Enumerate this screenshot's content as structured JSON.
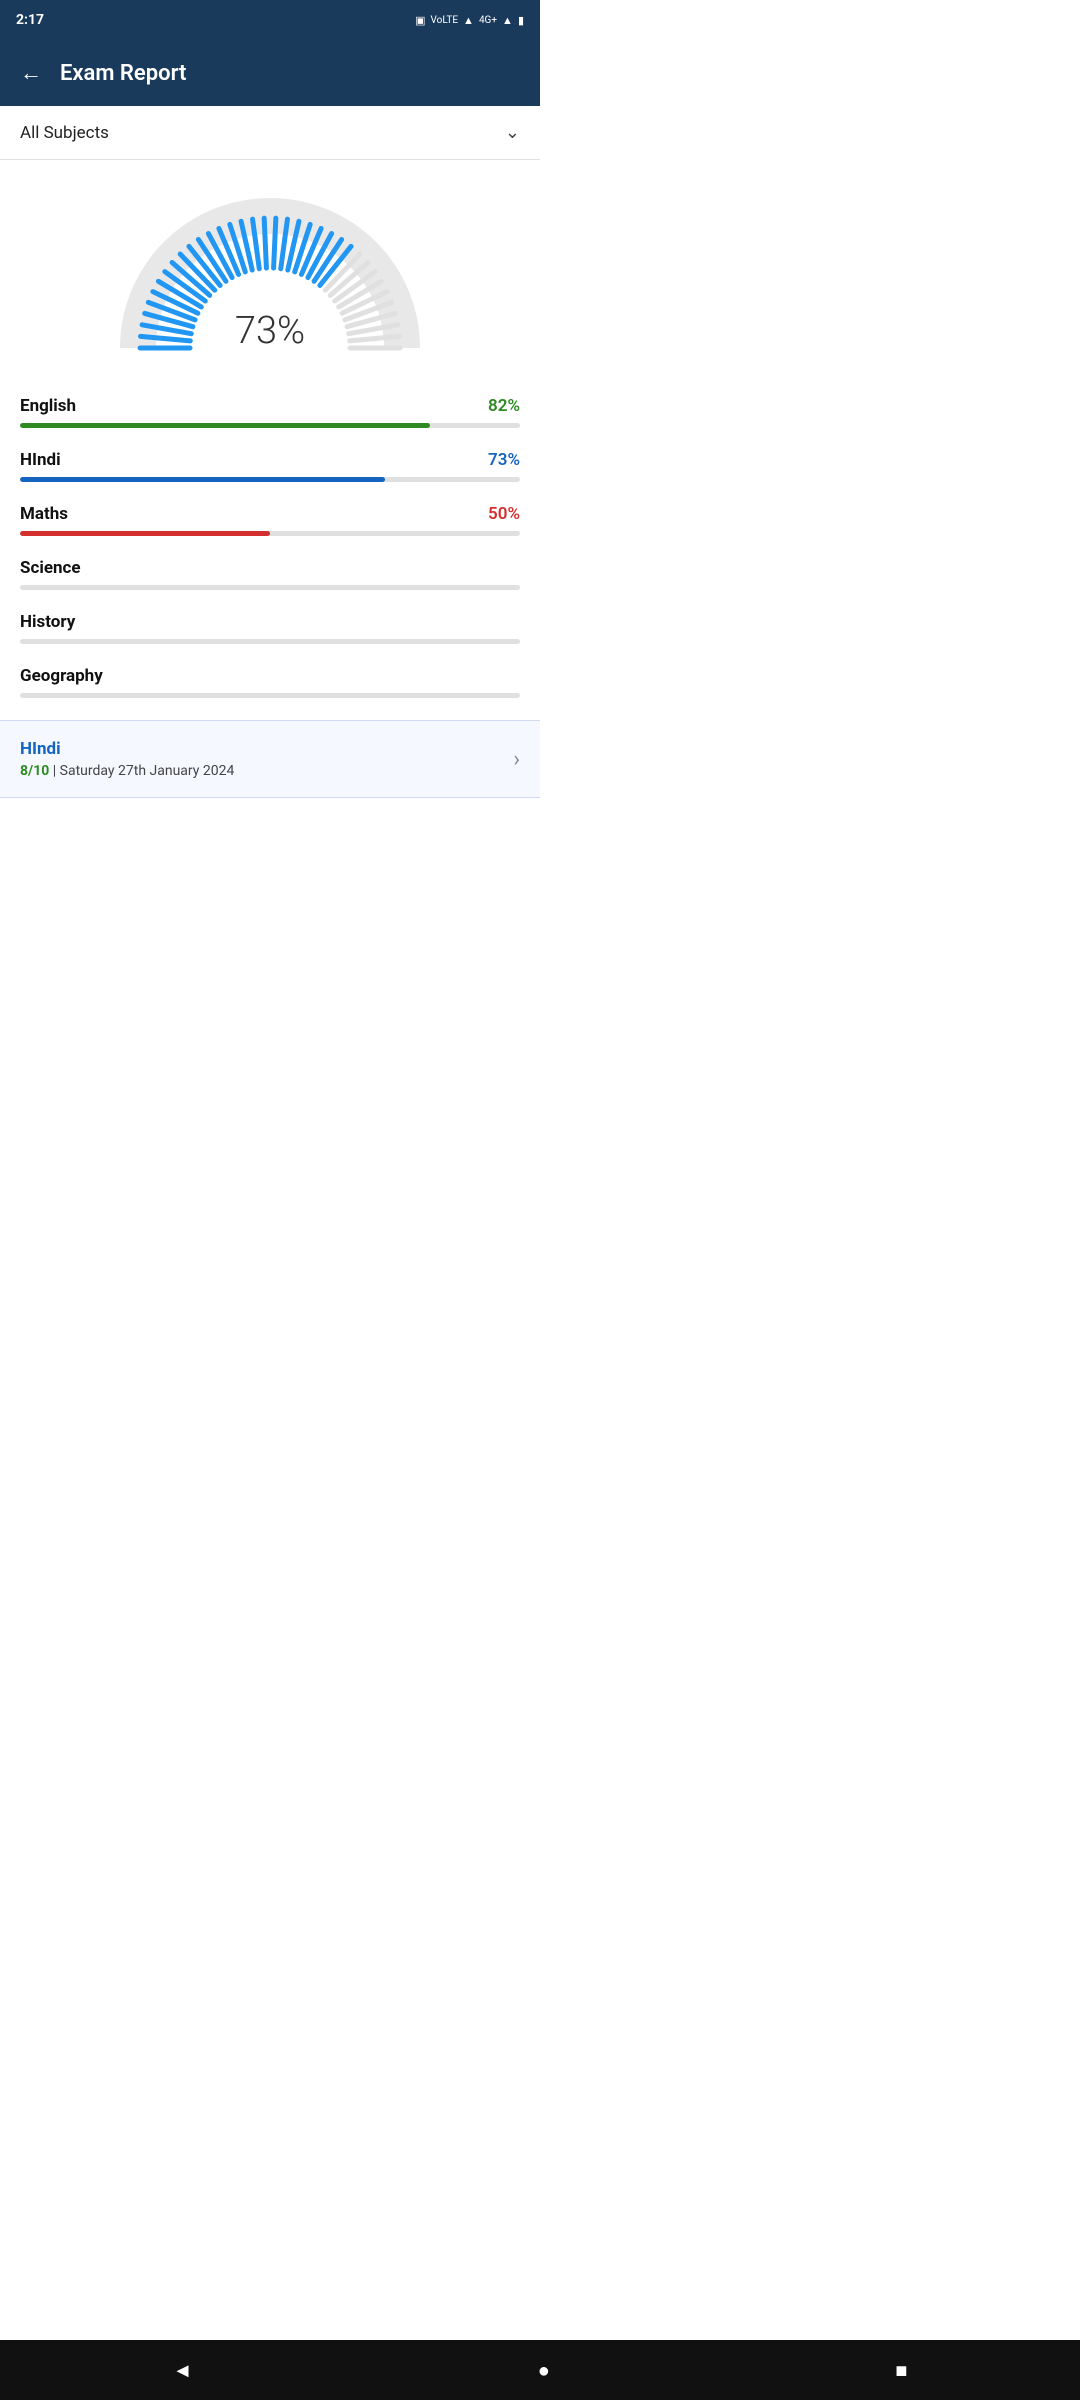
{
  "statusBar": {
    "time": "2:17",
    "icons": [
      "vibrate",
      "volte",
      "wifi",
      "4g+",
      "signal",
      "battery"
    ]
  },
  "header": {
    "backArrow": "←",
    "title": "Exam Report"
  },
  "subjectDropdown": {
    "label": "All Subjects",
    "chevron": "⌄"
  },
  "gauge": {
    "percent": "73%",
    "value": 73,
    "fillColor": "#2196f3",
    "emptyColor": "#e8e8e8"
  },
  "subjects": [
    {
      "name": "English",
      "percent": "82%",
      "value": 82,
      "colorClass": "green",
      "fillClass": "fill-green"
    },
    {
      "name": "HIndi",
      "percent": "73%",
      "value": 73,
      "colorClass": "blue",
      "fillClass": "fill-blue"
    },
    {
      "name": "Maths",
      "percent": "50%",
      "value": 50,
      "colorClass": "red",
      "fillClass": "fill-red"
    },
    {
      "name": "Science",
      "percent": "",
      "value": 0,
      "colorClass": "",
      "fillClass": "fill-gray"
    },
    {
      "name": "History",
      "percent": "",
      "value": 0,
      "colorClass": "",
      "fillClass": "fill-gray"
    },
    {
      "name": "Geography",
      "percent": "",
      "value": 0,
      "colorClass": "",
      "fillClass": "fill-gray"
    }
  ],
  "examRecord": {
    "subject": "HIndi",
    "score": "8/10",
    "separator": "|",
    "date": "Saturday 27th January 2024",
    "chevron": "›"
  },
  "navBar": {
    "back": "◄",
    "home": "●",
    "recents": "■"
  }
}
